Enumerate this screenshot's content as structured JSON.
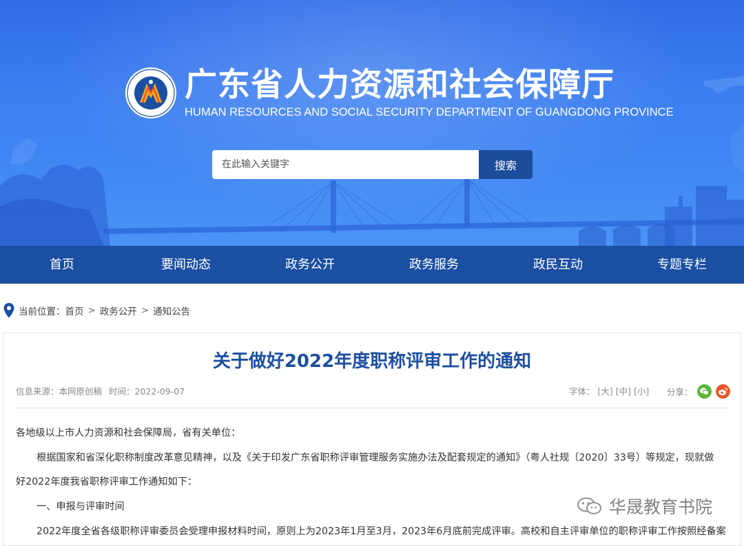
{
  "header": {
    "title": "广东省人力资源和社会保障厅",
    "subtitle": "HUMAN RESOURCES AND SOCIAL SECURITY DEPARTMENT OF GUANGDONG PROVINCE",
    "emblem_icon": "hrss-emblem-icon"
  },
  "search": {
    "placeholder": "在此输入关键字",
    "button_label": "搜索"
  },
  "nav": {
    "items": [
      {
        "label": "首页"
      },
      {
        "label": "要闻动态"
      },
      {
        "label": "政务公开"
      },
      {
        "label": "政务服务"
      },
      {
        "label": "政民互动"
      },
      {
        "label": "专题专栏"
      }
    ]
  },
  "breadcrumb": {
    "prefix": "当前位置：",
    "items": [
      "首页",
      "政务公开",
      "通知公告"
    ],
    "separator": ">"
  },
  "article": {
    "title": "关于做好2022年度职称评审工作的通知",
    "source": "信息来源：本网原创稿",
    "time": "时间：2022-09-07",
    "font_label": "字体：",
    "font_sizes": [
      "[大]",
      "[中]",
      "[小]"
    ],
    "share_label": "分享：",
    "paragraphs": [
      "各地级以上市人力资源和社会保障局，省有关单位：",
      "根据国家和省深化职称制度改革意见精神，以及《关于印发广东省职称评审管理服务实施办法及配套规定的通知》（粤人社规〔2020〕33号）等规定，现就做",
      "好2022年度我省职称评审工作通知如下：",
      "一、申报与评审时间",
      "2022年度全省各级职称评审委员会受理申报材料时间，原则上为2023年1月至3月，2023年6月底前完成评审。高校和自主评审单位的职称评审工作按照经备案"
    ]
  },
  "watermark": {
    "text": "华晟教育书院"
  },
  "colors": {
    "banner_blue": "#3b7df0",
    "nav_blue": "#1b4fa2",
    "title_blue": "#1d4f9f",
    "search_button": "#1c4c9c",
    "wechat_green": "#5bb53c",
    "weibo_orange": "#e8562a"
  }
}
